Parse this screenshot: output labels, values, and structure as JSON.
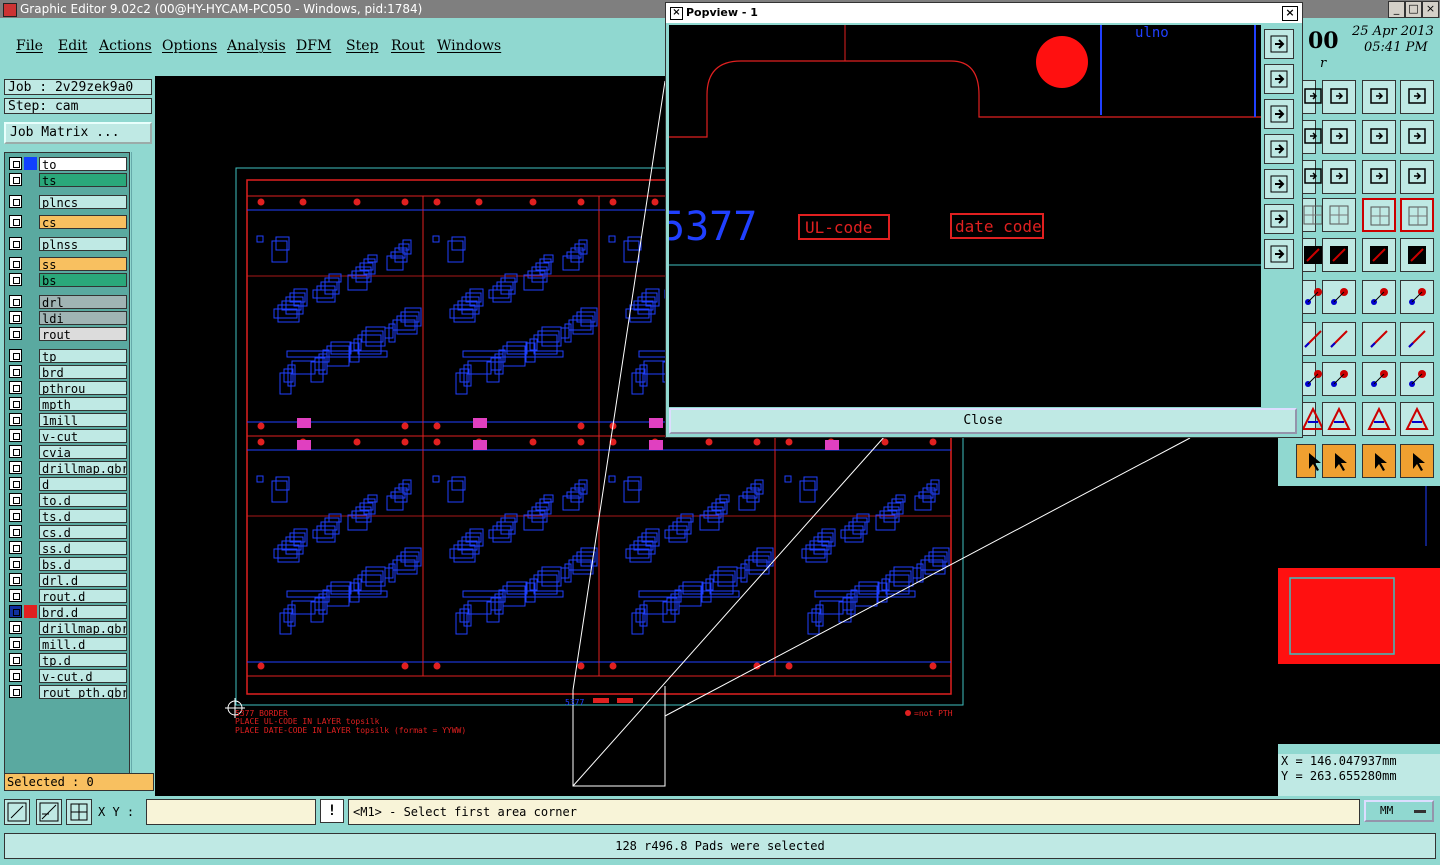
{
  "window": {
    "title": "Graphic Editor 9.02c2 (00@HY-HYCAM-PC050 - Windows, pid:1784)"
  },
  "menu": [
    "File",
    "Edit",
    "Actions",
    "Options",
    "Analysis",
    "DFM",
    "Step",
    "Rout",
    "Windows"
  ],
  "job": {
    "job_line": "Job : 2v29zek9a0",
    "step_line": "Step: cam",
    "matrix_button": "Job Matrix ..."
  },
  "layers": [
    {
      "name": "to",
      "color": "#ffffff",
      "swatch": "#1040ff"
    },
    {
      "name": "ts",
      "color": "#2aa87a",
      "swatch": ""
    },
    {
      "name": "plncs",
      "color": "#bfe9e4",
      "swatch": ""
    },
    {
      "name": "cs",
      "color": "#f8c060",
      "swatch": ""
    },
    {
      "name": "plnss",
      "color": "#bfe9e4",
      "swatch": ""
    },
    {
      "name": "ss",
      "color": "#f8c060",
      "swatch": ""
    },
    {
      "name": "bs",
      "color": "#2aa87a",
      "swatch": ""
    },
    {
      "name": "drl",
      "color": "#a0b4b4",
      "swatch": ""
    },
    {
      "name": "ldi",
      "color": "#a0b4b4",
      "swatch": ""
    },
    {
      "name": "rout",
      "color": "#dcdcdc",
      "swatch": ""
    },
    {
      "name": "tp",
      "color": "#bfe9e4",
      "swatch": ""
    },
    {
      "name": "brd",
      "color": "#bfe9e4",
      "swatch": ""
    },
    {
      "name": "pthrou",
      "color": "#bfe9e4",
      "swatch": ""
    },
    {
      "name": "mpth",
      "color": "#bfe9e4",
      "swatch": ""
    },
    {
      "name": "1mill",
      "color": "#bfe9e4",
      "swatch": ""
    },
    {
      "name": "v-cut",
      "color": "#bfe9e4",
      "swatch": ""
    },
    {
      "name": "cvia",
      "color": "#bfe9e4",
      "swatch": ""
    },
    {
      "name": "drillmap.gbr",
      "color": "#bfe9e4",
      "swatch": ""
    },
    {
      "name": "d",
      "color": "#bfe9e4",
      "swatch": ""
    },
    {
      "name": "to.d",
      "color": "#bfe9e4",
      "swatch": ""
    },
    {
      "name": "ts.d",
      "color": "#bfe9e4",
      "swatch": ""
    },
    {
      "name": "cs.d",
      "color": "#bfe9e4",
      "swatch": ""
    },
    {
      "name": "ss.d",
      "color": "#bfe9e4",
      "swatch": ""
    },
    {
      "name": "bs.d",
      "color": "#bfe9e4",
      "swatch": ""
    },
    {
      "name": "drl.d",
      "color": "#bfe9e4",
      "swatch": ""
    },
    {
      "name": "rout.d",
      "color": "#bfe9e4",
      "swatch": ""
    },
    {
      "name": "brd.d",
      "color": "#bfe9e4",
      "swatch": "#e02020"
    },
    {
      "name": "drillmap.gbr",
      "color": "#bfe9e4",
      "swatch": ""
    },
    {
      "name": "mill.d",
      "color": "#bfe9e4",
      "swatch": ""
    },
    {
      "name": "tp.d",
      "color": "#bfe9e4",
      "swatch": ""
    },
    {
      "name": "v-cut.d",
      "color": "#bfe9e4",
      "swatch": ""
    },
    {
      "name": "rout_pth.gbr",
      "color": "#bfe9e4",
      "swatch": ""
    }
  ],
  "selected": "Selected : 0",
  "command": {
    "xy_label": "X Y :",
    "xy_value": "",
    "prompt": "<M1> - Select first area corner",
    "units": "MM"
  },
  "status": "128 r496.8 Pads were selected",
  "clock": {
    "time_prefix": "00",
    "date": "25 Apr 2013",
    "time": "05:41 PM",
    "extra": "r"
  },
  "coords": {
    "x": "X  = 146.047937mm",
    "y": "Y  = 263.655280mm"
  },
  "popview": {
    "title": "Popview - 1",
    "close_label": "Close",
    "part_text": "5377",
    "ul_label": "UL-code",
    "date_label": "date code",
    "top_text": "ulno"
  },
  "board_notes": {
    "line1": "5377  BORDER",
    "line2": "PLACE UL-CODE IN LAYER topsilk",
    "line3": "PLACE DATE-CODE IN LAYER topsilk (format = YYWW)",
    "legend": "=not PTH",
    "part_small": "5377"
  },
  "colors": {
    "panel": "#90d8d0",
    "panel_light": "#bfe9e4",
    "board_red": "#e02020",
    "board_blue": "#2040ff",
    "outline_cyan": "#3fbfbf"
  }
}
